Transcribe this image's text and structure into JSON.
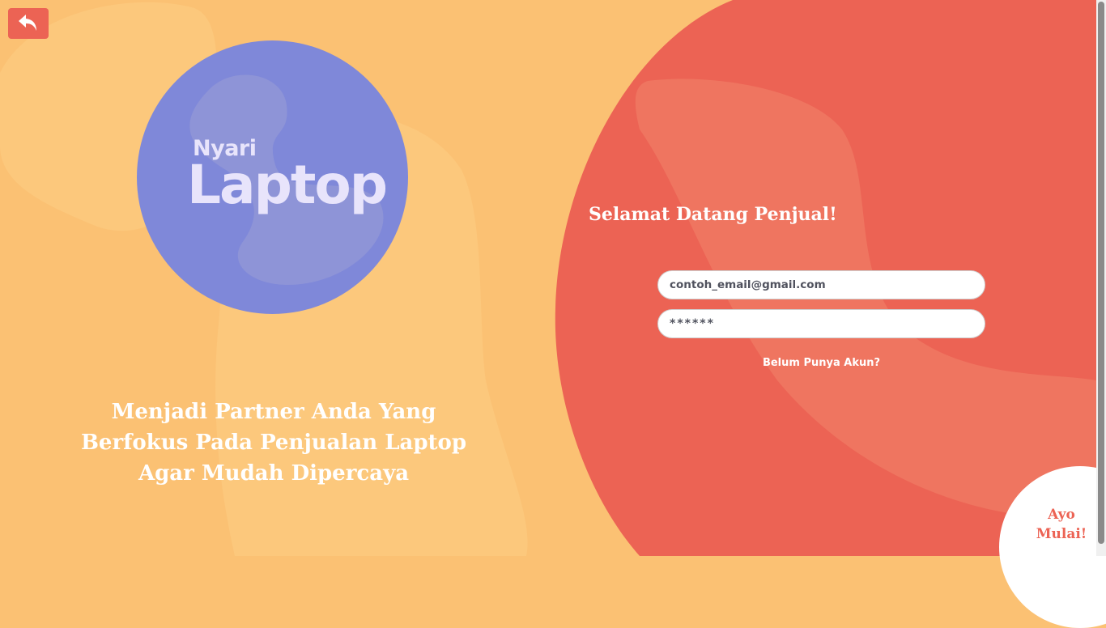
{
  "nav": {
    "back_icon": "undo-arrow-icon"
  },
  "logo": {
    "small": "Nyari",
    "big": "Laptop"
  },
  "tagline": {
    "line1": "Menjadi Partner Anda Yang",
    "line2": "Berfokus Pada Penjualan Laptop",
    "line3": "Agar Mudah Dipercaya"
  },
  "login": {
    "title": "Selamat Datang Penjual!",
    "email_placeholder": "contoh_email@gmail.com",
    "password_placeholder": "******",
    "signup_link": "Belum Punya Akun?"
  },
  "cta": {
    "line1": "Ayo",
    "line2": "Mulai!"
  },
  "colors": {
    "background": "#fbc173",
    "accent": "#ec6354",
    "logo_circle": "#7f88d9",
    "white": "#ffffff"
  }
}
